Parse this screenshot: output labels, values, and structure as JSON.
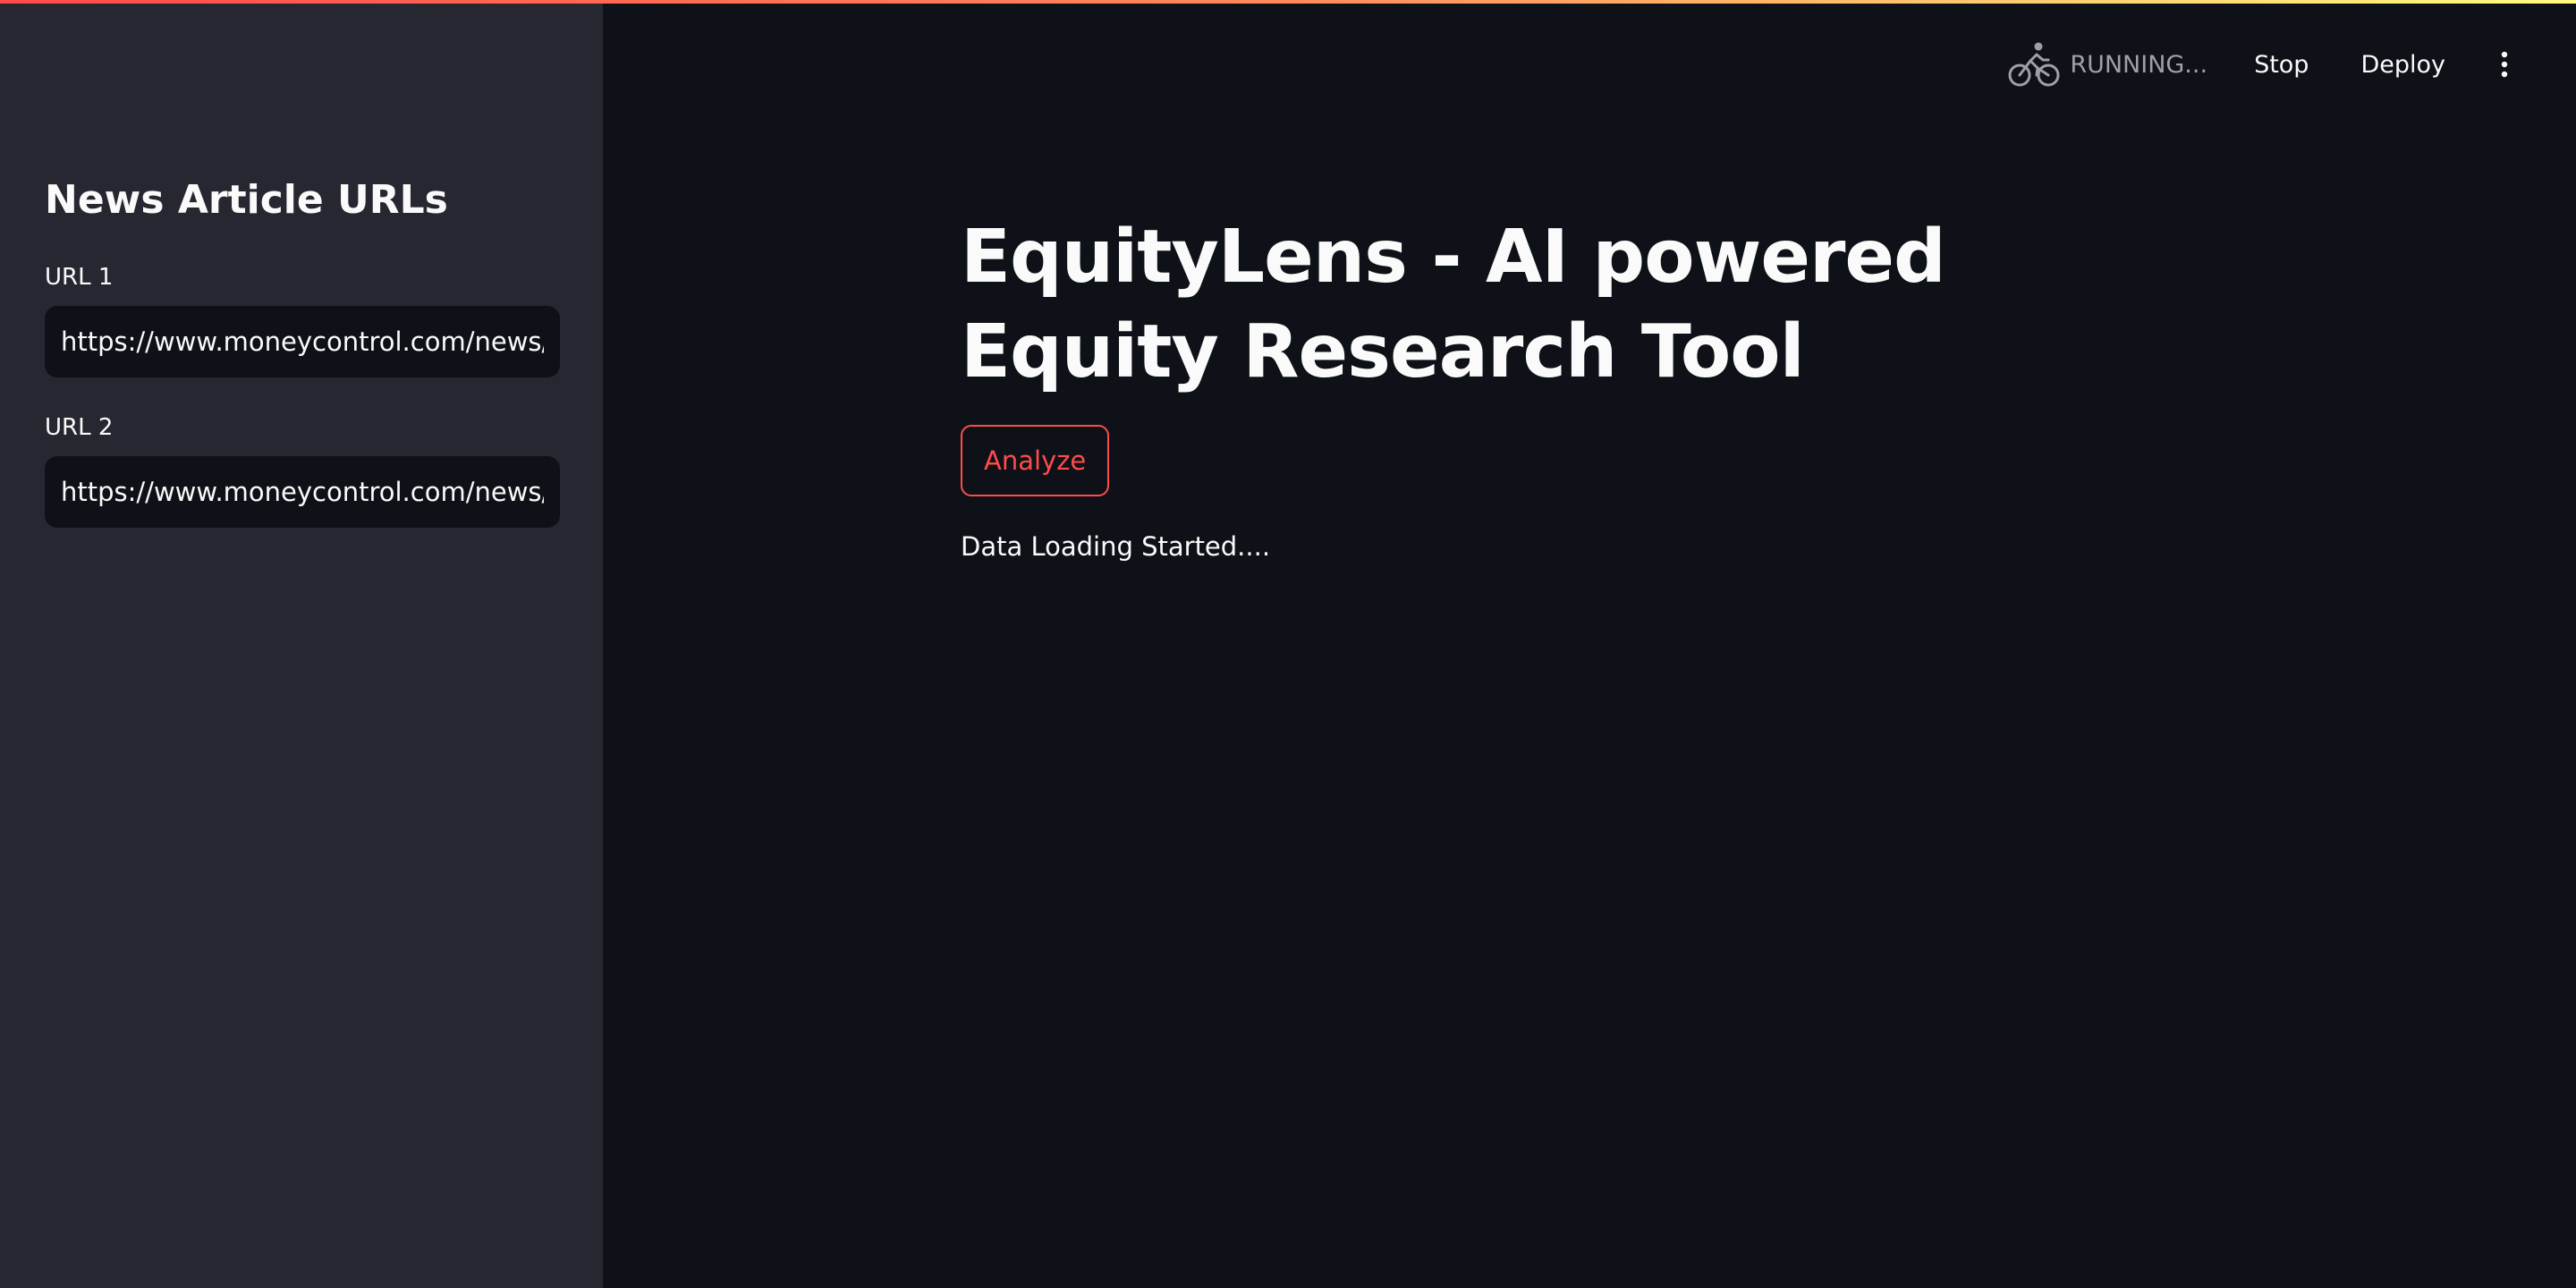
{
  "header": {
    "status_text": "RUNNING...",
    "stop_label": "Stop",
    "deploy_label": "Deploy"
  },
  "sidebar": {
    "title": "News Article URLs",
    "fields": [
      {
        "label": "URL 1",
        "value": "https://www.moneycontrol.com/news/b"
      },
      {
        "label": "URL 2",
        "value": "https://www.moneycontrol.com/news/ir"
      }
    ]
  },
  "main": {
    "title": "EquityLens - AI powered Equity Research Tool",
    "analyze_label": "Analyze",
    "status_message": "Data Loading Started...."
  },
  "icons": {
    "status": "bicycle-icon",
    "menu": "more-vertical-icon"
  },
  "colors": {
    "background": "#0e1117",
    "sidebar": "#262730",
    "accent": "#ff4b4b",
    "text": "#fafafa",
    "muted": "#9ea0a8"
  }
}
